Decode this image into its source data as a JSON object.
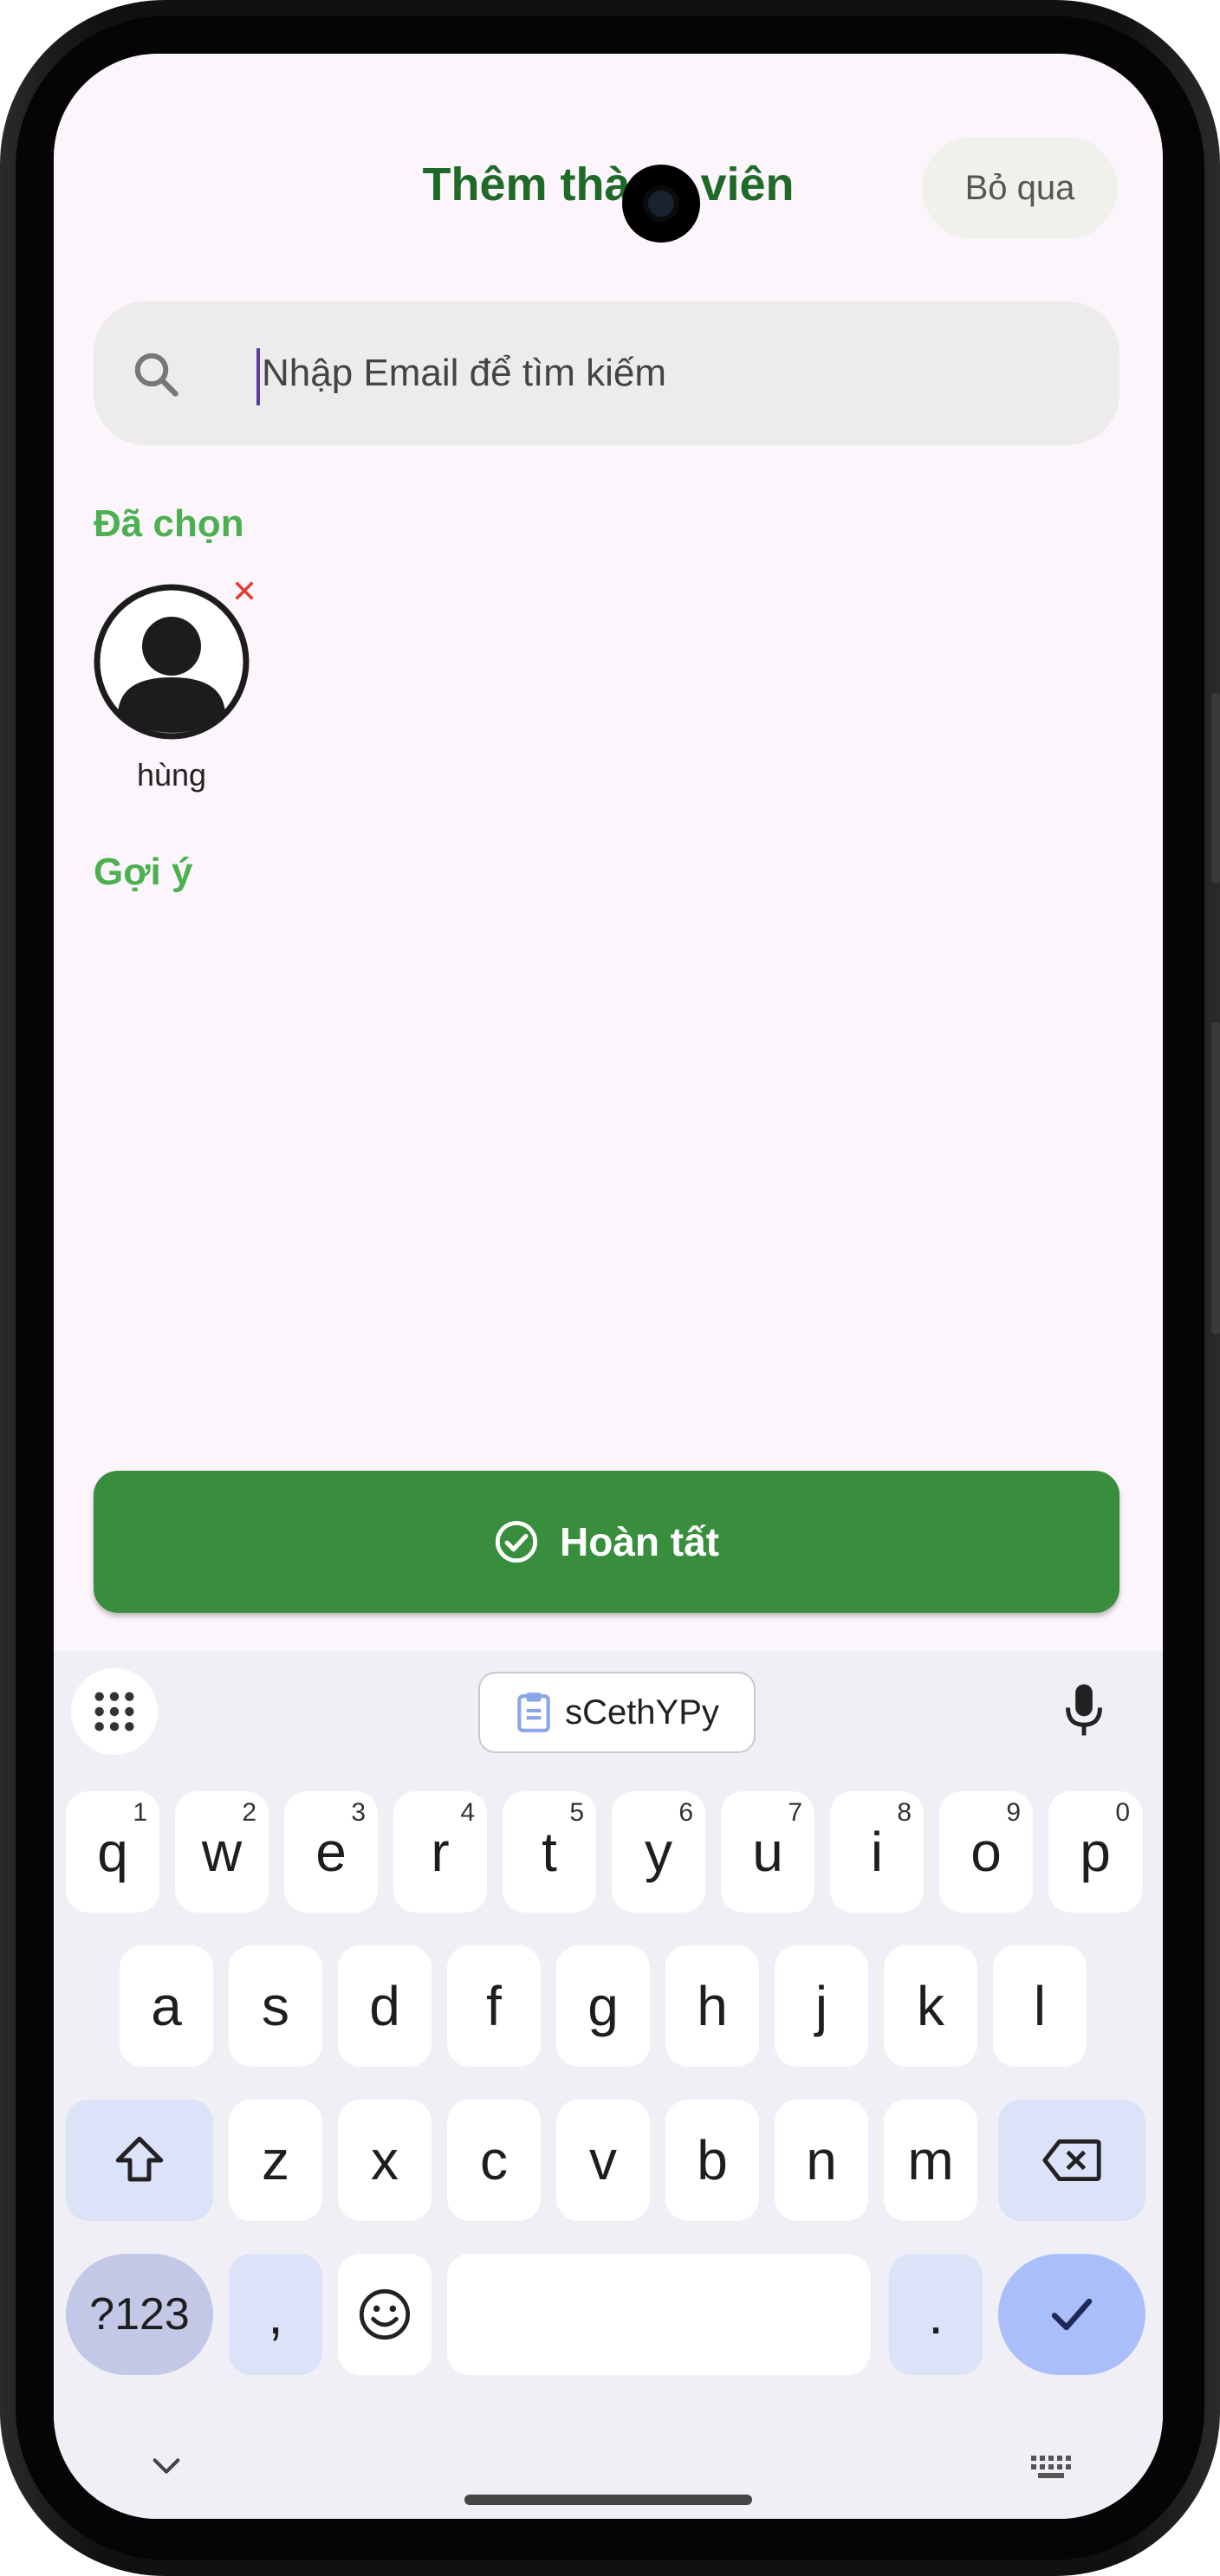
{
  "header": {
    "title": "Thêm thành viên",
    "skip_label": "Bỏ qua"
  },
  "search": {
    "placeholder": "Nhập Email để tìm kiếm"
  },
  "selected": {
    "heading": "Đã chọn",
    "users": [
      {
        "name": "hùng"
      }
    ]
  },
  "suggestions": {
    "heading": "Gợi ý"
  },
  "done_button": {
    "label": "Hoàn tất"
  },
  "keyboard": {
    "clipboard_suggestion": "sCethYPy",
    "row1": [
      {
        "k": "q",
        "s": "1"
      },
      {
        "k": "w",
        "s": "2"
      },
      {
        "k": "e",
        "s": "3"
      },
      {
        "k": "r",
        "s": "4"
      },
      {
        "k": "t",
        "s": "5"
      },
      {
        "k": "y",
        "s": "6"
      },
      {
        "k": "u",
        "s": "7"
      },
      {
        "k": "i",
        "s": "8"
      },
      {
        "k": "o",
        "s": "9"
      },
      {
        "k": "p",
        "s": "0"
      }
    ],
    "row2": [
      "a",
      "s",
      "d",
      "f",
      "g",
      "h",
      "j",
      "k",
      "l"
    ],
    "row3": [
      "z",
      "x",
      "c",
      "v",
      "b",
      "n",
      "m"
    ],
    "symbols_label": "?123",
    "comma_label": ",",
    "period_label": "."
  },
  "colors": {
    "title_green": "#1f6a28",
    "section_green": "#4cb050",
    "button_green": "#388e3c",
    "remove_red": "#e53935"
  }
}
